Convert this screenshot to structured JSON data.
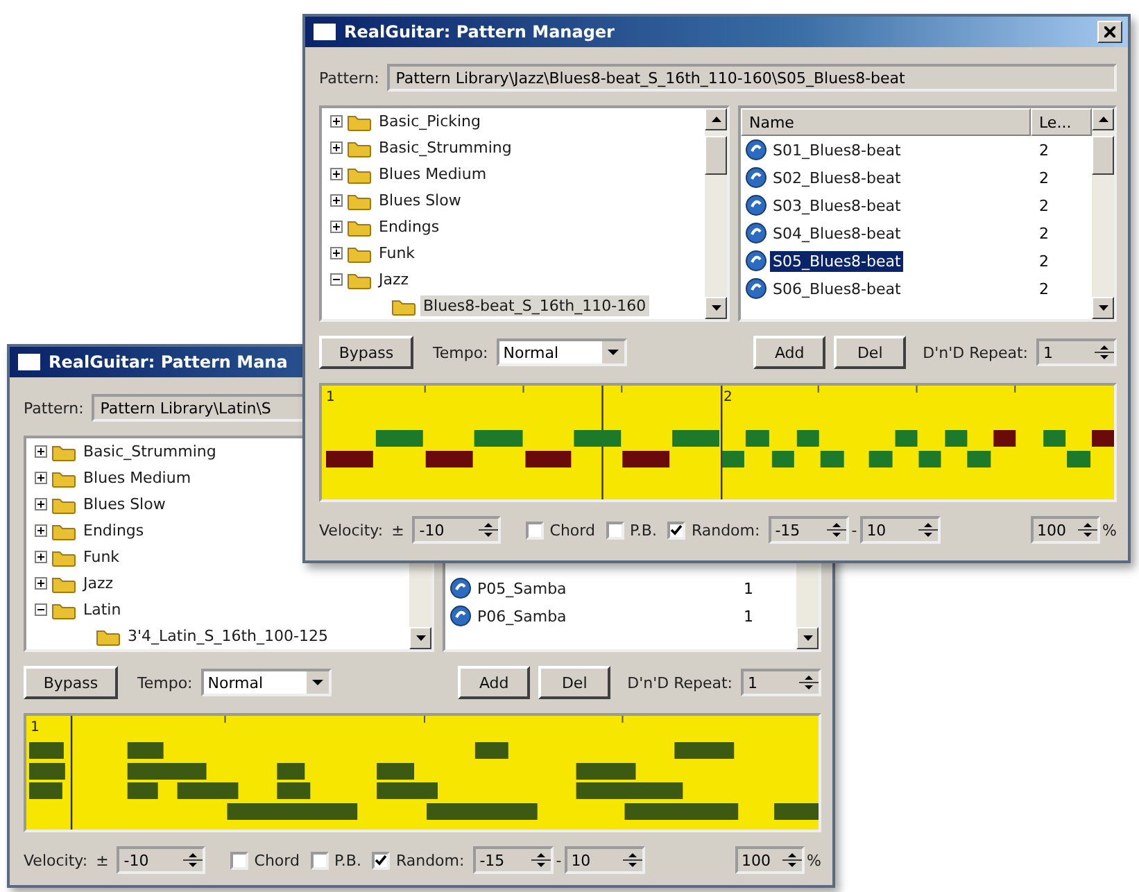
{
  "windows": [
    {
      "title": "RealGuitar: Pattern Manager",
      "pattern_label": "Pattern:",
      "pattern": "Pattern Library\\Jazz\\Blues8-beat_S_16th_110-160\\S05_Blues8-beat",
      "tree": [
        {
          "label": "Basic_Picking",
          "expanded": false,
          "selected": false
        },
        {
          "label": "Basic_Strumming",
          "expanded": false,
          "selected": false
        },
        {
          "label": "Blues Medium",
          "expanded": false,
          "selected": false
        },
        {
          "label": "Blues Slow",
          "expanded": false,
          "selected": false
        },
        {
          "label": "Endings",
          "expanded": false,
          "selected": false
        },
        {
          "label": "Funk",
          "expanded": false,
          "selected": false
        },
        {
          "label": "Jazz",
          "expanded": true,
          "selected": false,
          "children": [
            {
              "label": "Blues8-beat_S_16th_110-160",
              "selected": true
            }
          ]
        }
      ],
      "list": {
        "columns": [
          "Name",
          "Le..."
        ],
        "rows": [
          {
            "name": "S01_Blues8-beat",
            "length": "2",
            "selected": false
          },
          {
            "name": "S02_Blues8-beat",
            "length": "2",
            "selected": false
          },
          {
            "name": "S03_Blues8-beat",
            "length": "2",
            "selected": false
          },
          {
            "name": "S04_Blues8-beat",
            "length": "2",
            "selected": false
          },
          {
            "name": "S05_Blues8-beat",
            "length": "2",
            "selected": true
          },
          {
            "name": "S06_Blues8-beat",
            "length": "2",
            "selected": false
          }
        ]
      },
      "bypass": "Bypass",
      "tempo_label": "Tempo:",
      "tempo": "Normal",
      "add": "Add",
      "del": "Del",
      "repeat_label": "D'n'D Repeat:",
      "repeat": "1",
      "roll": {
        "kind": "accent",
        "bar_numbers": [
          "1",
          "2"
        ]
      },
      "velocity_label": "Velocity:",
      "plusminus": "±",
      "velocity": "-10",
      "options": [
        {
          "label": "Chord",
          "checked": false
        },
        {
          "label": "P.B.",
          "checked": false
        },
        {
          "label": "Random:",
          "checked": true
        }
      ],
      "random_min": "-15",
      "dash": "-",
      "random_max": "10",
      "percent_value": "100",
      "percent": "%"
    },
    {
      "title": "RealGuitar: Pattern Mana",
      "pattern_label": "Pattern:",
      "pattern": "Pattern Library\\Latin\\S",
      "tree": [
        {
          "label": "Basic_Strumming",
          "expanded": false,
          "selected": false
        },
        {
          "label": "Blues Medium",
          "expanded": false,
          "selected": false
        },
        {
          "label": "Blues Slow",
          "expanded": false,
          "selected": false
        },
        {
          "label": "Endings",
          "expanded": false,
          "selected": false
        },
        {
          "label": "Funk",
          "expanded": false,
          "selected": false
        },
        {
          "label": "Jazz",
          "expanded": false,
          "selected": false
        },
        {
          "label": "Latin",
          "expanded": true,
          "selected": false,
          "children": [
            {
              "label": "3'4_Latin_S_16th_100-125",
              "selected": false
            }
          ]
        }
      ],
      "list": {
        "rows": [
          {
            "name": "P05_Samba",
            "length": "1",
            "selected": false
          },
          {
            "name": "P06_Samba",
            "length": "1",
            "selected": false
          }
        ]
      },
      "bypass": "Bypass",
      "tempo_label": "Tempo:",
      "tempo": "Normal",
      "add": "Add",
      "del": "Del",
      "repeat_label": "D'n'D Repeat:",
      "repeat": "1",
      "roll": {
        "kind": "chords",
        "bar_numbers": [
          "1"
        ]
      },
      "velocity_label": "Velocity:",
      "plusminus": "±",
      "velocity": "-10",
      "options": [
        {
          "label": "Chord",
          "checked": false
        },
        {
          "label": "P.B.",
          "checked": false
        },
        {
          "label": "Random:",
          "checked": true
        }
      ],
      "random_min": "-15",
      "dash": "-",
      "random_max": "10",
      "percent_value": "100",
      "percent": "%"
    }
  ]
}
